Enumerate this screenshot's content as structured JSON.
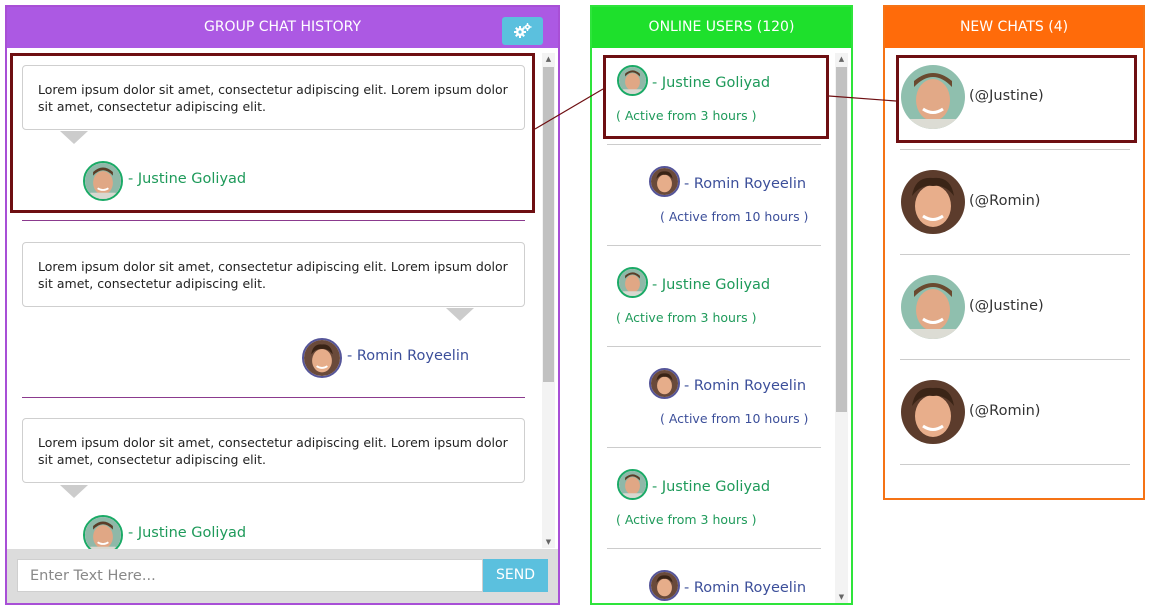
{
  "group_chat": {
    "title": "GROUP CHAT HISTORY",
    "settings_icon": "gears-icon",
    "messages": [
      {
        "text": "Lorem ipsum dolor sit amet, consectetur adipiscing elit. Lorem ipsum dolor sit amet, consectetur adipiscing elit.",
        "sender": "- Justine Goliyad"
      },
      {
        "text": "Lorem ipsum dolor sit amet, consectetur adipiscing elit. Lorem ipsum dolor sit amet, consectetur adipiscing elit.",
        "sender": "- Romin Royeelin"
      },
      {
        "text": "Lorem ipsum dolor sit amet, consectetur adipiscing elit. Lorem ipsum dolor sit amet, consectetur adipiscing elit.",
        "sender": "- Justine Goliyad"
      }
    ],
    "input_placeholder": "Enter Text Here...",
    "send_label": "SEND"
  },
  "online_users": {
    "title": "ONLINE USERS (120)",
    "users": [
      {
        "name": "- Justine Goliyad",
        "status": "( Active from 3 hours )"
      },
      {
        "name": "- Romin Royeelin",
        "status": "( Active from 10 hours )"
      },
      {
        "name": "- Justine Goliyad",
        "status": "( Active from 3 hours )"
      },
      {
        "name": "- Romin Royeelin",
        "status": "( Active from 10 hours )"
      },
      {
        "name": "- Justine Goliyad",
        "status": "( Active from 3 hours )"
      },
      {
        "name": "- Romin Royeelin",
        "status": ""
      }
    ]
  },
  "new_chats": {
    "title": "NEW CHATS (4)",
    "chats": [
      {
        "handle": "(@Justine)"
      },
      {
        "handle": "(@Romin)"
      },
      {
        "handle": "(@Justine)"
      },
      {
        "handle": "(@Romin)"
      }
    ]
  },
  "colors": {
    "group_chat_accent": "#ac59e3",
    "online_accent": "#1ee02c",
    "new_chats_accent": "#ff6b0a",
    "button_blue": "#5bc0de",
    "highlight": "#6e0f12"
  }
}
